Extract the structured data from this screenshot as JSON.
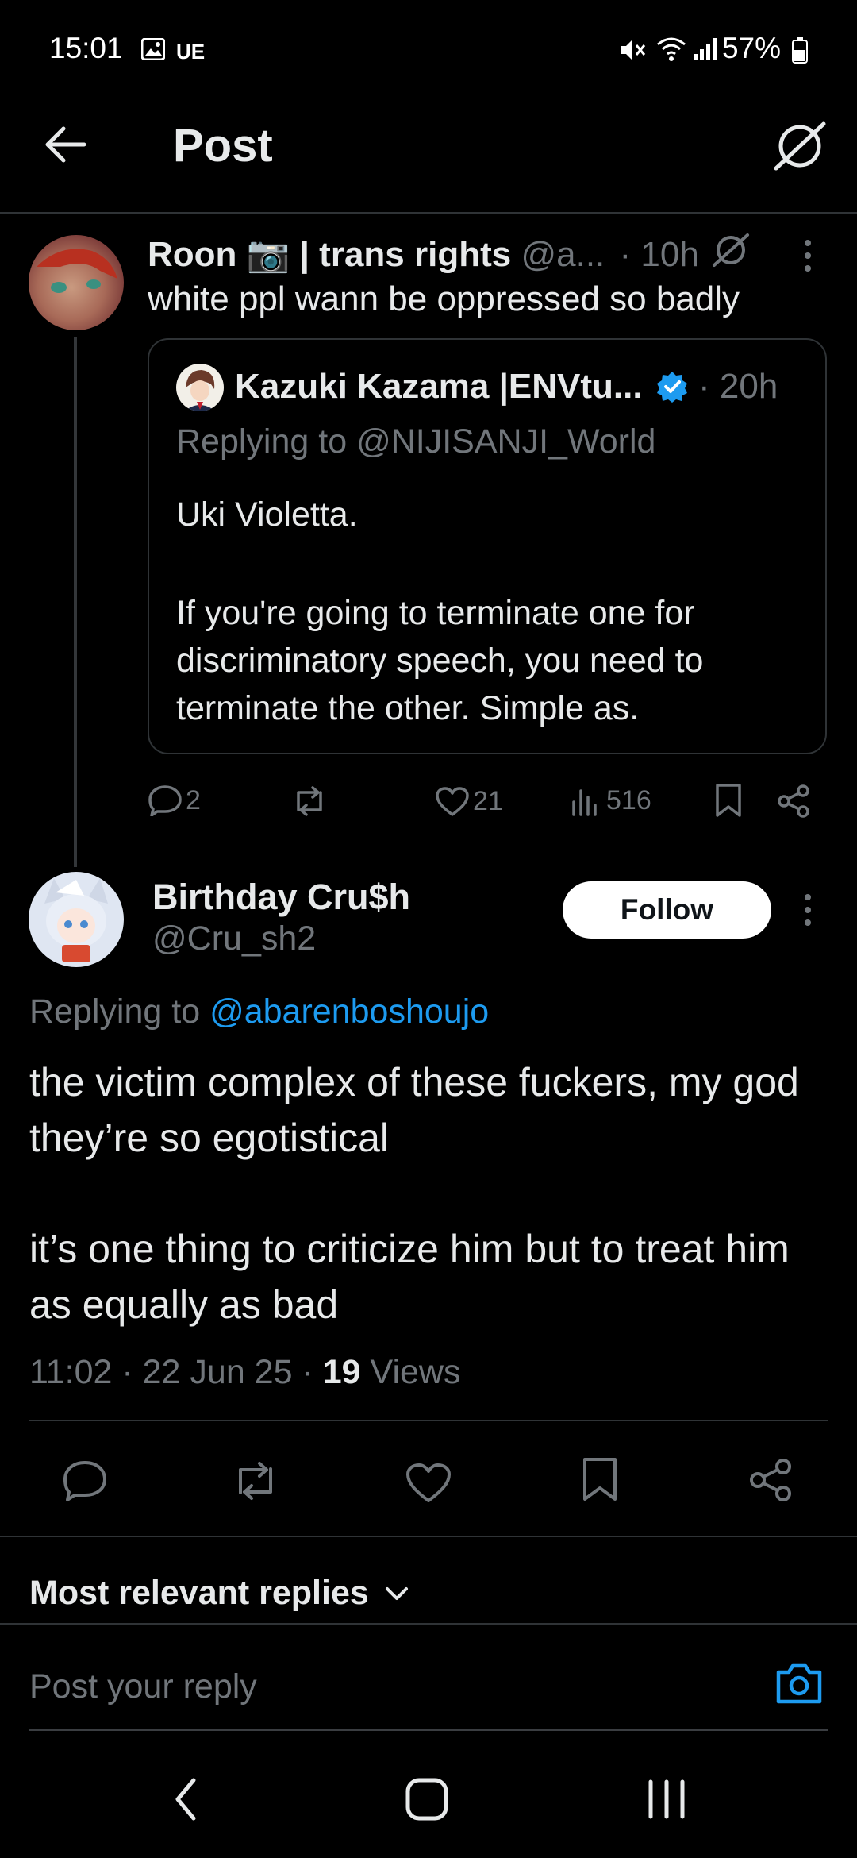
{
  "status_bar": {
    "time": "15:01",
    "carrier_tag": "UE",
    "battery": "57%"
  },
  "header": {
    "title": "Post"
  },
  "parent_tweet": {
    "display_name": "Roon 📷 | trans rights",
    "handle": "@a...",
    "time": "· 10h",
    "text": "white ppl wann be oppressed so badly",
    "quote": {
      "display_name": "Kazuki Kazama |ENVtu...",
      "time": "· 20h",
      "replying_to_prefix": "Replying to ",
      "replying_to_handle": "@NIJISANJI_World",
      "text_line1": "Uki Violetta.",
      "text_line2": "If you're going to terminate one for discriminatory speech, you need to terminate the other. Simple as."
    },
    "stats": {
      "replies": "2",
      "likes": "21",
      "views": "516"
    }
  },
  "main_tweet": {
    "display_name": "Birthday Cru$h",
    "handle": "@Cru_sh2",
    "follow_label": "Follow",
    "replying_to_prefix": "Replying to ",
    "replying_to_handle": "@abarenboshoujo",
    "paragraph1": "the victim complex of these fuckers, my god they’re so egotistical",
    "paragraph2": "it’s one thing to criticize him but to treat him as equally as bad",
    "time": "11:02",
    "date": "22 Jun 25",
    "views_count": "19",
    "views_label": "Views"
  },
  "replies_sort": {
    "label": "Most relevant replies"
  },
  "reply_box": {
    "placeholder": "Post your reply"
  },
  "colors": {
    "background": "#000000",
    "text": "#e7e9ea",
    "muted": "#71767b",
    "accent": "#1d9bf0",
    "divider": "#2f3336"
  }
}
